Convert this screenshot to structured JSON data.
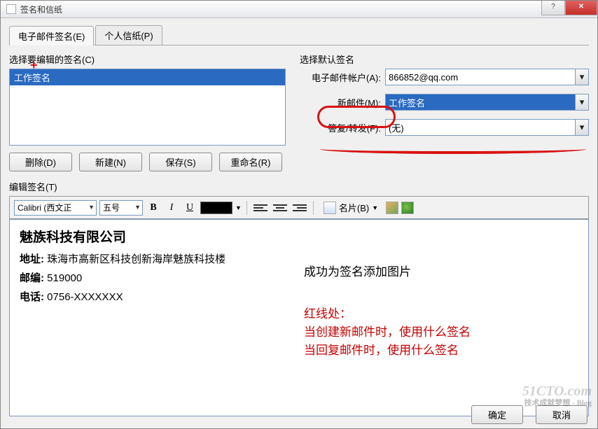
{
  "window": {
    "title": "签名和信纸"
  },
  "tabs": {
    "email_sig": "电子邮件签名(E)",
    "stationery": "个人信纸(P)"
  },
  "left": {
    "label": "选择要编辑的签名(C)",
    "selected_item": "工作签名",
    "buttons": {
      "delete": "删除(D)",
      "new": "新建(N)",
      "save": "保存(S)",
      "rename": "重命名(R)"
    }
  },
  "right": {
    "label": "选择默认签名",
    "account_label": "电子邮件帐户(A):",
    "account_value": "866852@qq.com",
    "new_label": "新邮件(M):",
    "new_value": "工作签名",
    "reply_label": "答复/转发(F):",
    "reply_value": "(无)"
  },
  "editor": {
    "label": "编辑签名(T)",
    "font": "Calibri (西文正",
    "size": "五号",
    "card": "名片(B)"
  },
  "signature": {
    "company": "魅族科技有限公司",
    "address_label": "地址:",
    "address": "珠海市高新区科技创新海岸魅族科技楼",
    "zip_label": "邮编:",
    "zip": "519000",
    "phone_label": "电话:",
    "phone": "0756-XXXXXXX"
  },
  "notes": {
    "success": "成功为签名添加图片",
    "red1": "红线处：",
    "red2": "当创建新邮件时，使用什么签名",
    "red3": "当回复邮件时，使用什么签名"
  },
  "footer": {
    "ok": "确定",
    "cancel": "取消"
  },
  "watermark": {
    "main": "51CTO.com",
    "sub": "技术成就梦想 - Blog"
  }
}
